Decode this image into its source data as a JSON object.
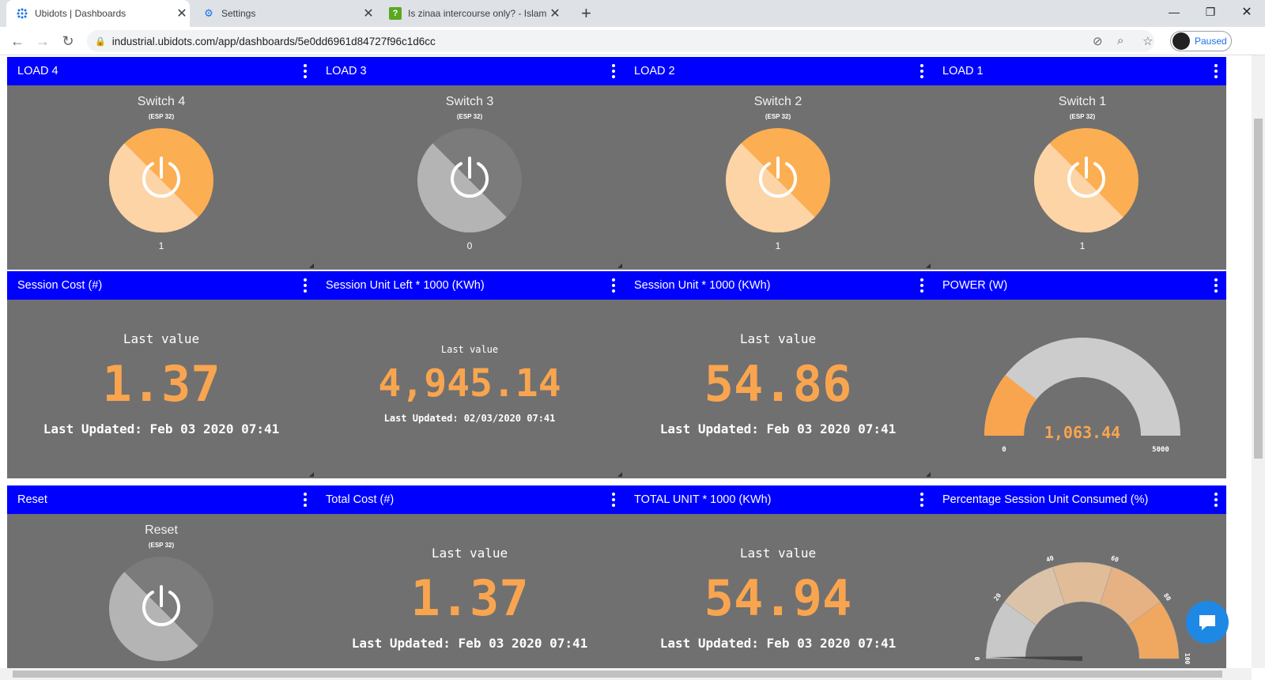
{
  "browser": {
    "tabs": [
      {
        "title": "Ubidots | Dashboards",
        "icon": "ubidots-icon",
        "active": true
      },
      {
        "title": "Settings",
        "icon": "gear-icon",
        "active": false
      },
      {
        "title": "Is zinaa intercourse only? - Islam",
        "icon": "question-icon",
        "active": false
      }
    ],
    "url": "industrial.ubidots.com/app/dashboards/5e0dd6961d84727f96c1d6cc",
    "profile_label": "Paused"
  },
  "colors": {
    "header": "#0000ff",
    "card": "#707070",
    "accent": "#f9a54f",
    "switch_on": "#fcae52",
    "switch_off": "#b4b4b4"
  },
  "switches": [
    {
      "header": "LOAD 4",
      "name": "Switch 4",
      "sub": "(ESP 32)",
      "value": "1",
      "on": true
    },
    {
      "header": "LOAD 3",
      "name": "Switch 3",
      "sub": "(ESP 32)",
      "value": "0",
      "on": false
    },
    {
      "header": "LOAD 2",
      "name": "Switch 2",
      "sub": "(ESP 32)",
      "value": "1",
      "on": true
    },
    {
      "header": "LOAD 1",
      "name": "Switch 1",
      "sub": "(ESP 32)",
      "value": "1",
      "on": true
    }
  ],
  "row2": {
    "session_cost": {
      "header": "Session Cost (#)",
      "caption": "Last value",
      "value": "1.37",
      "updated": "Last Updated: Feb 03 2020 07:41"
    },
    "session_left": {
      "header": "Session Unit Left * 1000 (KWh)",
      "caption": "Last value",
      "value": "4,945.14",
      "updated": "Last Updated: 02/03/2020 07:41"
    },
    "session_unit": {
      "header": "Session Unit * 1000 (KWh)",
      "caption": "Last value",
      "value": "54.86",
      "updated": "Last Updated: Feb 03 2020 07:41"
    },
    "power": {
      "header": "POWER (W)",
      "value": "1,063.44",
      "min": "0",
      "max": "5000",
      "fraction": 0.213
    }
  },
  "row3": {
    "reset": {
      "header": "Reset",
      "name": "Reset",
      "sub": "(ESP 32)",
      "on": false
    },
    "total_cost": {
      "header": "Total Cost (#)",
      "caption": "Last value",
      "value": "1.37",
      "updated": "Last Updated: Feb 03 2020 07:41"
    },
    "total_unit": {
      "header": "TOTAL UNIT * 1000 (KWh)",
      "caption": "Last value",
      "value": "54.94",
      "updated": "Last Updated: Feb 03 2020 07:41"
    },
    "percent": {
      "header": "Percentage Session Unit Consumed (%)",
      "ticks": [
        "0",
        "20",
        "40",
        "60",
        "80",
        "100"
      ]
    }
  }
}
